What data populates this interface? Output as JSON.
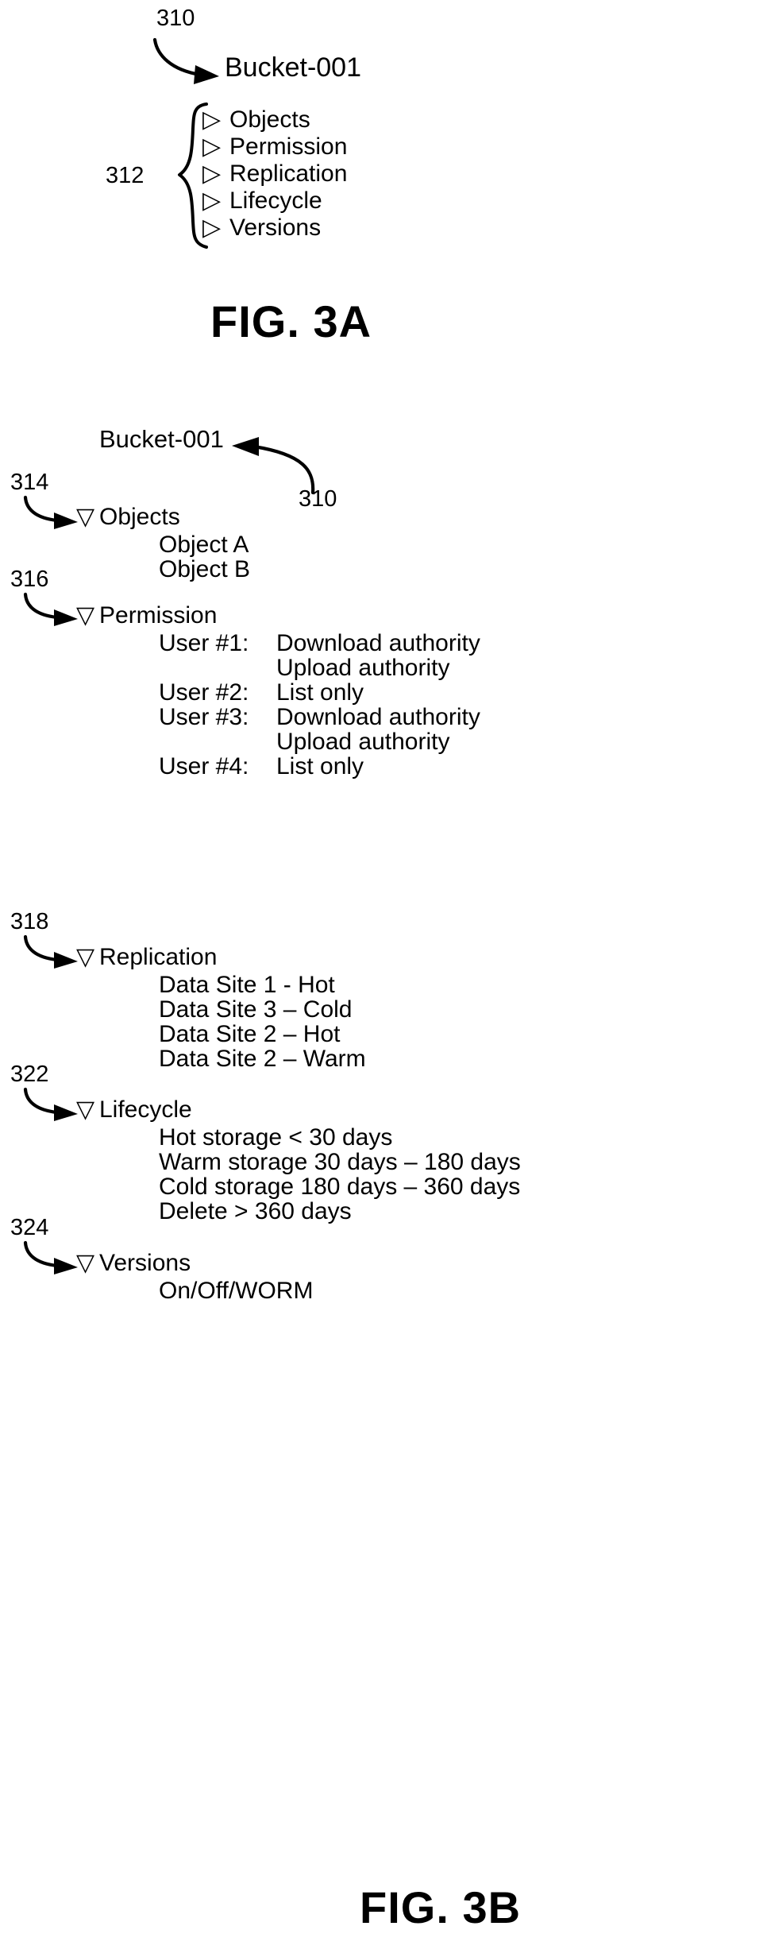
{
  "figures": [
    {
      "id": "fig-3a",
      "caption": "FIG. 3A",
      "root": {
        "label": "Bucket-001",
        "ref": "310"
      },
      "group": {
        "ref": "312",
        "marker": "collapsed-triangle",
        "items": [
          "Objects",
          "Permission",
          "Replication",
          "Lifecycle",
          "Versions"
        ]
      }
    },
    {
      "id": "fig-3b",
      "caption": "FIG. 3B",
      "root": {
        "label": "Bucket-001",
        "ref": "310"
      },
      "sections": [
        {
          "ref": "314",
          "marker": "expanded-triangle",
          "title": "Objects",
          "rows": [
            {
              "left": "Object A",
              "right": ""
            },
            {
              "left": "Object B",
              "right": ""
            }
          ]
        },
        {
          "ref": "316",
          "marker": "expanded-triangle",
          "title": "Permission",
          "rows": [
            {
              "left": "User #1:",
              "right": "Download authority"
            },
            {
              "left": "",
              "right": "Upload authority"
            },
            {
              "left": "User #2:",
              "right": "List only"
            },
            {
              "left": "User #3:",
              "right": "Download authority"
            },
            {
              "left": "",
              "right": "Upload authority"
            },
            {
              "left": "User #4:",
              "right": "List only"
            }
          ]
        },
        {
          "ref": "318",
          "marker": "expanded-triangle",
          "title": "Replication",
          "rows": [
            {
              "left": "Data Site 1 - Hot",
              "right": ""
            },
            {
              "left": "Data Site 3 – Cold",
              "right": ""
            },
            {
              "left": "Data Site 2 – Hot",
              "right": ""
            },
            {
              "left": "Data Site 2 – Warm",
              "right": ""
            }
          ]
        },
        {
          "ref": "322",
          "marker": "expanded-triangle",
          "title": "Lifecycle",
          "rows": [
            {
              "left": "Hot storage < 30 days",
              "right": ""
            },
            {
              "left": "Warm storage 30 days – 180 days",
              "right": ""
            },
            {
              "left": "Cold storage 180 days – 360 days",
              "right": ""
            },
            {
              "left": "Delete > 360 days",
              "right": ""
            }
          ]
        },
        {
          "ref": "324",
          "marker": "expanded-triangle",
          "title": "Versions",
          "rows": [
            {
              "left": "On/Off/WORM",
              "right": ""
            }
          ]
        }
      ]
    }
  ],
  "icons": {
    "collapsed": "▷",
    "expanded": "▽"
  }
}
